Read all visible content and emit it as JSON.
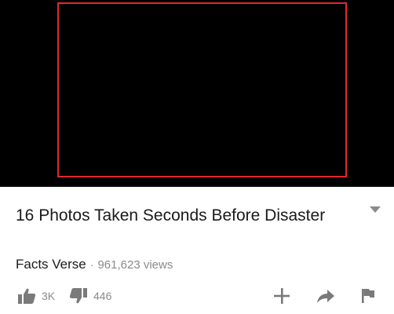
{
  "video": {
    "title": "16 Photos Taken Seconds Before Disaster",
    "channel": "Facts Verse",
    "separator": "·",
    "views": "961,623 views"
  },
  "actions": {
    "like_count": "3K",
    "dislike_count": "446"
  },
  "icons": {
    "expand": "chevron-down-icon",
    "like": "thumbs-up-icon",
    "dislike": "thumbs-down-icon",
    "add": "plus-icon",
    "share": "share-arrow-icon",
    "report": "flag-icon"
  },
  "colors": {
    "player_background": "#000000",
    "highlight_border": "#e0292e",
    "icon_gray": "#7a7a7a",
    "secondary_text": "#8a8a8a"
  }
}
